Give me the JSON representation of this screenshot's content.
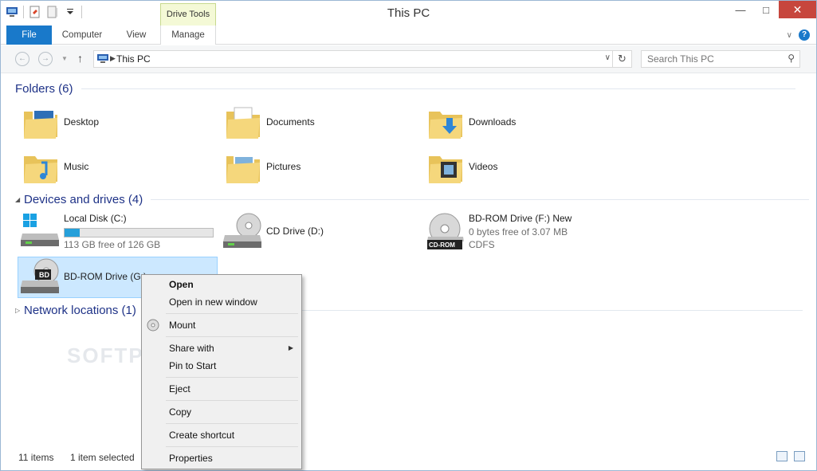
{
  "window": {
    "title": "This PC"
  },
  "ribbon": {
    "contextual_label": "Drive Tools",
    "tabs": [
      "File",
      "Computer",
      "View",
      "Manage"
    ]
  },
  "nav": {
    "address_crumb": "This PC",
    "search_placeholder": "Search This PC"
  },
  "groups": {
    "folders": {
      "title": "Folders (6)",
      "items": [
        "Desktop",
        "Documents",
        "Downloads",
        "Music",
        "Pictures",
        "Videos"
      ]
    },
    "devices": {
      "title": "Devices and drives (4)",
      "drives": [
        {
          "name": "Local Disk (C:)",
          "free_text": "113 GB free of 126 GB",
          "used_fraction": 0.1
        },
        {
          "name": "CD Drive (D:)"
        },
        {
          "name": "BD-ROM Drive (F:) New",
          "free_text": "0 bytes free of 3.07 MB",
          "fs": "CDFS",
          "badge": "CD-ROM"
        },
        {
          "name": "BD-ROM Drive (G:)",
          "badge": "BD"
        }
      ]
    },
    "network": {
      "title": "Network locations (1)"
    }
  },
  "status": {
    "items": "11 items",
    "selected": "1 item selected"
  },
  "context_menu": {
    "items": [
      "Open",
      "Open in new window",
      "Mount",
      "Share with",
      "Pin to Start",
      "Eject",
      "Copy",
      "Create shortcut",
      "Properties"
    ]
  },
  "watermark": "SOFTPEDIA",
  "colors": {
    "accent": "#1979ca",
    "selection": "#cce8ff",
    "group_header": "#1e3287",
    "close": "#c7463d"
  }
}
